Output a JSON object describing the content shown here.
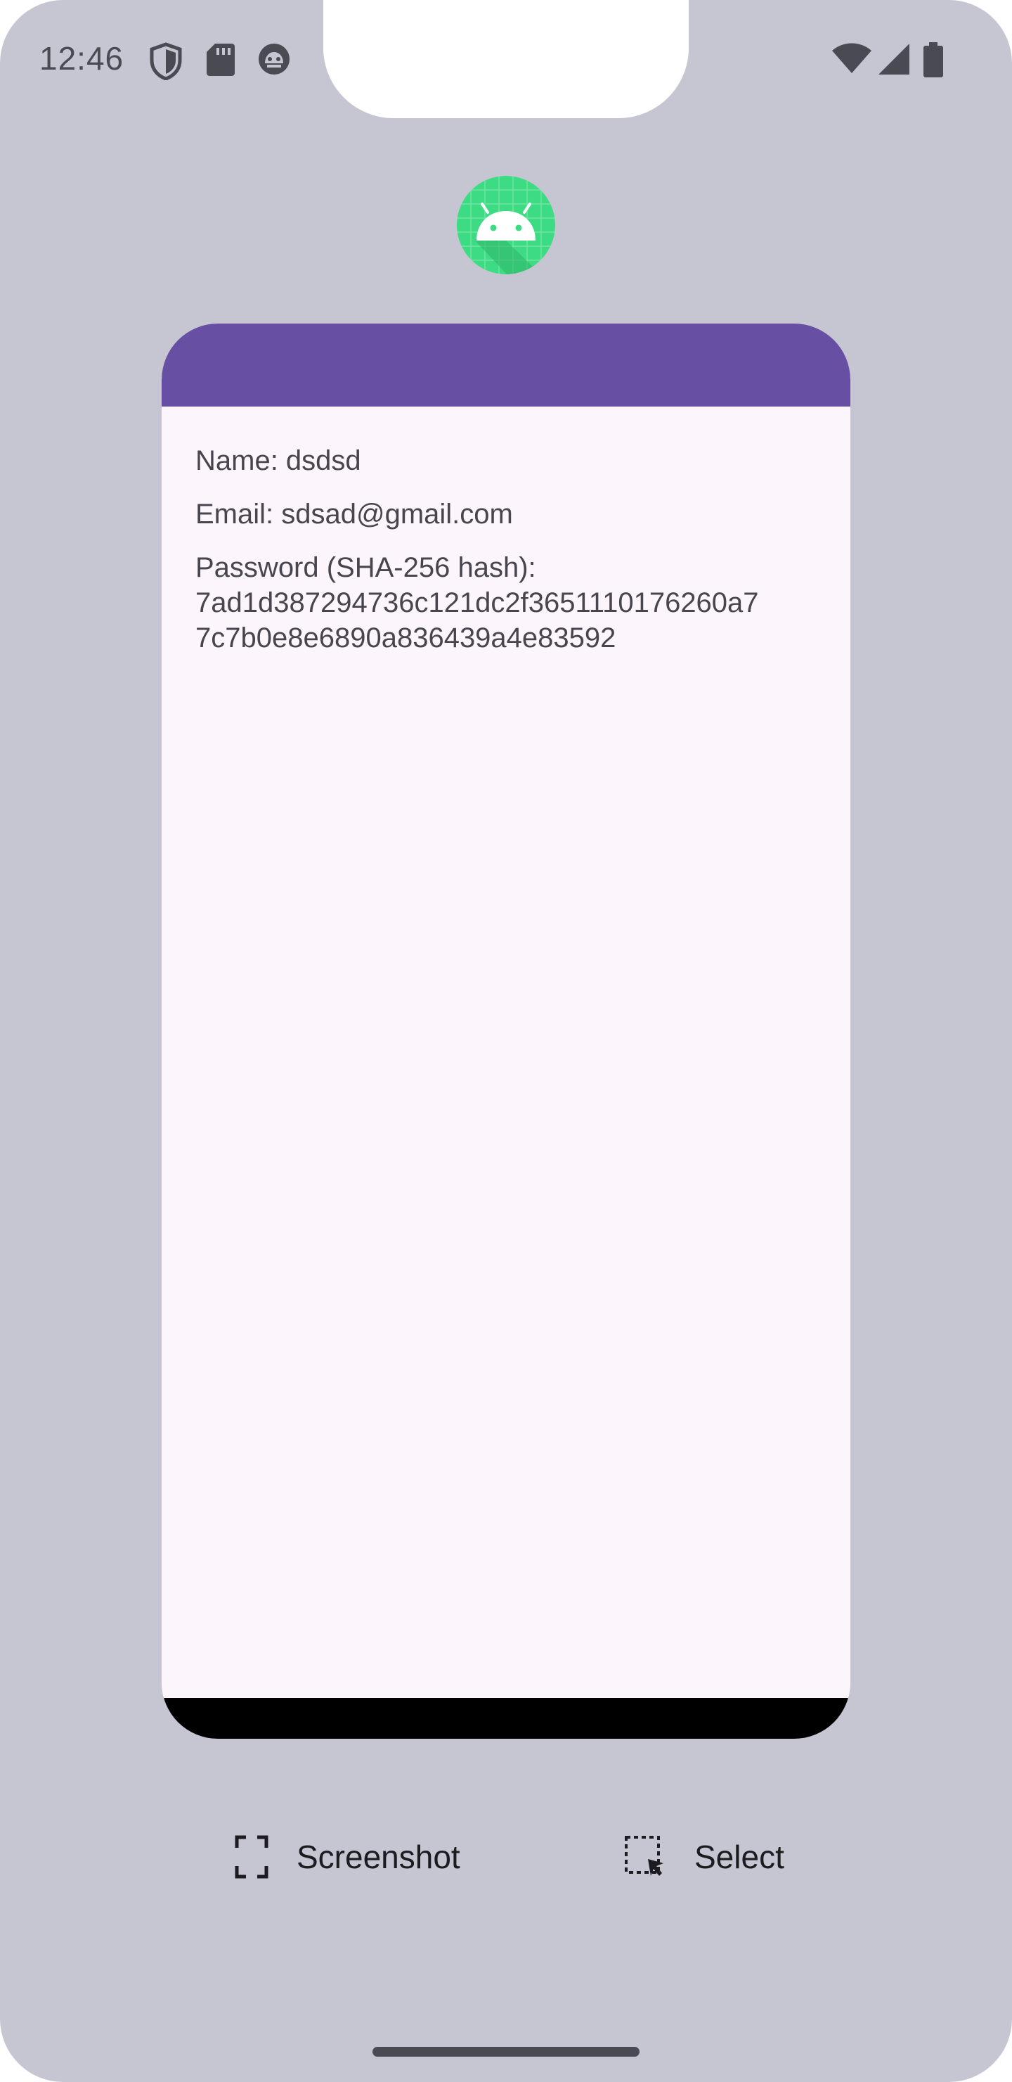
{
  "status_bar": {
    "time": "12:46",
    "left_icons": [
      "shield-icon",
      "sd-card-icon",
      "android-robot-face-icon"
    ],
    "right_icons": [
      "wifi-icon",
      "signal-icon",
      "battery-icon"
    ]
  },
  "app": {
    "icon": "android-app-icon",
    "header_color": "#6750a4"
  },
  "details": {
    "name_line": "Name: dsdsd",
    "email_line": "Email: sdsad@gmail.com",
    "password_label": "Password (SHA-256 hash):",
    "password_hash_line1": "7ad1d387294736c121dc2f3651110176260a7",
    "password_hash_line2": "7c7b0e8e6890a836439a4e83592"
  },
  "actions": {
    "screenshot_label": "Screenshot",
    "select_label": "Select"
  },
  "colors": {
    "background": "#c6c6d2",
    "accent": "#6750a4",
    "card_body": "#fcf5fc",
    "app_icon": "#3ddc84"
  }
}
